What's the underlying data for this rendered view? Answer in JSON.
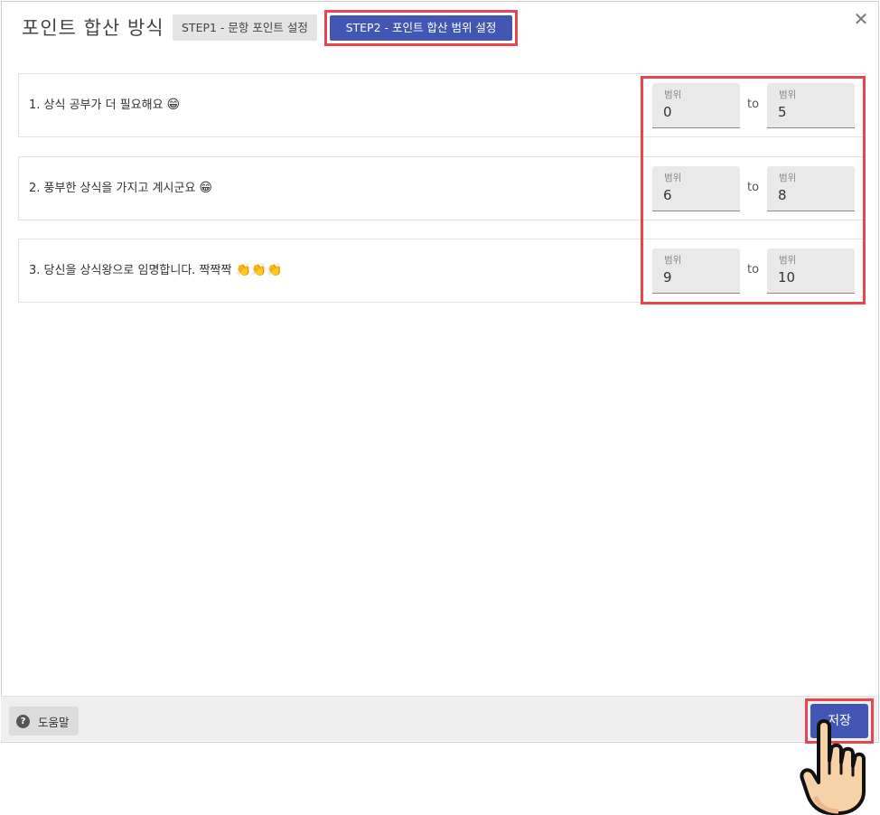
{
  "header": {
    "title": "포인트 합산 방식",
    "tabs": [
      {
        "label": "STEP1 - 문항 포인트 설정",
        "active": false
      },
      {
        "label": "STEP2 - 포인트 합산 범위 설정",
        "active": true
      }
    ],
    "close_icon": "close-icon"
  },
  "rows": [
    {
      "text": "1. 상식 공부가 더 필요해요",
      "emoji": "😁",
      "from_label": "범위",
      "from": "0",
      "to_word": "to",
      "to_label": "범위",
      "to": "5"
    },
    {
      "text": "2. 풍부한 상식을 가지고 계시군요",
      "emoji": "😁",
      "from_label": "범위",
      "from": "6",
      "to_word": "to",
      "to_label": "범위",
      "to": "8"
    },
    {
      "text": "3. 당신을 상식왕으로 임명합니다. 짝짝짝",
      "emoji": "👏👏👏",
      "from_label": "범위",
      "from": "9",
      "to_word": "to",
      "to_label": "범위",
      "to": "10"
    }
  ],
  "footer": {
    "help_label": "도움말",
    "help_icon": "?",
    "save_label": "저장"
  },
  "colors": {
    "primary": "#4256b3",
    "highlight": "#e8464f"
  }
}
